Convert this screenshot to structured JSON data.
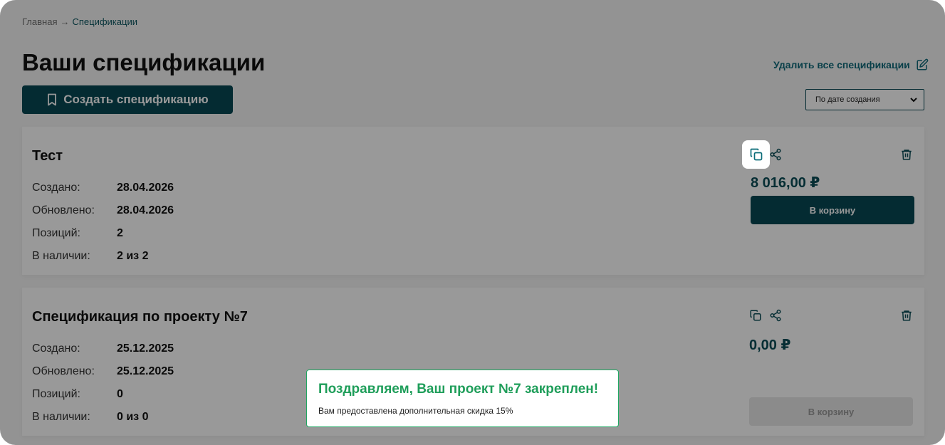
{
  "breadcrumb": {
    "home": "Главная",
    "separator": "→",
    "current": "Спецификации"
  },
  "page": {
    "title": "Ваши спецификации",
    "delete_all_label": "Удалить все спецификации",
    "create_button_label": "Создать спецификацию",
    "sort": {
      "selected": "По дате создания"
    }
  },
  "specs": [
    {
      "name": "Тест",
      "created_label": "Создано:",
      "created": "28.04.2026",
      "updated_label": "Обновлено:",
      "updated": "28.04.2026",
      "positions_label": "Позиций:",
      "positions": "2",
      "stock_label": "В наличии:",
      "stock": "2 из 2",
      "price": "8 016,00 ₽",
      "cart_label": "В корзину"
    },
    {
      "name": "Спецификация по проекту №7",
      "created_label": "Создано:",
      "created": "25.12.2025",
      "updated_label": "Обновлено:",
      "updated": "25.12.2025",
      "positions_label": "Позиций:",
      "positions": "0",
      "stock_label": "В наличии:",
      "stock": "0 из 0",
      "price": "0,00 ₽",
      "cart_label": "В корзину"
    }
  ],
  "toast": {
    "title": "Поздравляем, Ваш проект №7 закреплен!",
    "text": "Вам предоставлена дополнительная скидка 15%"
  },
  "colors": {
    "primary": "#084854",
    "accent_green": "#1f9e5a",
    "link": "#0f6a7a"
  },
  "icons": [
    "copy-icon",
    "share-icon",
    "trash-icon",
    "edit-icon",
    "bookmark-icon",
    "chevron-down-icon"
  ]
}
